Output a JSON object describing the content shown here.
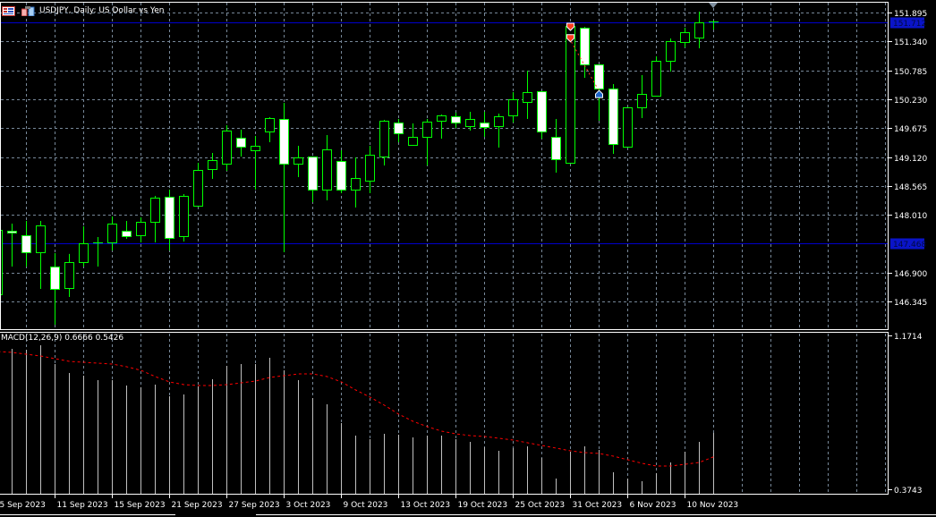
{
  "window": {
    "symbol_title": "USDJPY, Daily:  US Dollar vs Yen"
  },
  "price_axis": {
    "ticks": [
      "151.895",
      "151.340",
      "150.785",
      "150.230",
      "149.675",
      "149.120",
      "148.565",
      "148.010",
      "146.900",
      "146.345"
    ],
    "bid_label": "151.712",
    "level_label": "147.468"
  },
  "macd_axis": {
    "top": "1.1714",
    "bottom": "0.3743"
  },
  "macd_pane": {
    "label": "MACD(12,26,9) 0.6666 0.5426"
  },
  "time_axis": {
    "labels": [
      "5 Sep 2023",
      "11 Sep 2023",
      "15 Sep 2023",
      "21 Sep 2023",
      "27 Sep 2023",
      "3 Oct 2023",
      "9 Oct 2023",
      "13 Oct 2023",
      "19 Oct 2023",
      "25 Oct 2023",
      "31 Oct 2023",
      "6 Nov 2023",
      "10 Nov 2023"
    ]
  },
  "colors": {
    "background": "#000000",
    "candle_outline": "#00ff00",
    "bear_fill": "#ffffff",
    "bull_fill": "#000000",
    "grid": "#778899",
    "macd_hist": "#c0c0c0",
    "signal": "#ff0000",
    "level_line": "#0000cc",
    "sell_marker": "#ff3c1e",
    "buy_marker": "#1e64c8"
  },
  "chart_data": {
    "type": "candlestick",
    "title": "USDJPY, Daily",
    "price_range": [
      146.345,
      151.895
    ],
    "bid": 151.712,
    "level": 147.468,
    "candles": [
      {
        "date": "5 Sep 2023",
        "o": 146.483,
        "h": 147.84,
        "l": 146.483,
        "c": 147.72
      },
      {
        "date": "6 Sep 2023",
        "o": 147.703,
        "h": 147.84,
        "l": 147.016,
        "c": 147.669
      },
      {
        "date": "7 Sep 2023",
        "o": 147.617,
        "h": 147.892,
        "l": 147.016,
        "c": 147.291
      },
      {
        "date": "8 Sep 2023",
        "o": 147.291,
        "h": 147.892,
        "l": 146.586,
        "c": 147.806
      },
      {
        "date": "11 Sep 2023",
        "o": 147.016,
        "h": 147.274,
        "l": 145.899,
        "c": 146.586
      },
      {
        "date": "12 Sep 2023",
        "o": 146.604,
        "h": 147.257,
        "l": 146.432,
        "c": 147.102
      },
      {
        "date": "13 Sep 2023",
        "o": 147.102,
        "h": 147.789,
        "l": 147.016,
        "c": 147.462
      },
      {
        "date": "14 Sep 2023",
        "o": 147.462,
        "h": 147.583,
        "l": 147.016,
        "c": 147.48
      },
      {
        "date": "15 Sep 2023",
        "o": 147.48,
        "h": 147.978,
        "l": 147.325,
        "c": 147.84
      },
      {
        "date": "18 Sep 2023",
        "o": 147.703,
        "h": 147.892,
        "l": 147.548,
        "c": 147.6
      },
      {
        "date": "19 Sep 2023",
        "o": 147.617,
        "h": 147.961,
        "l": 147.48,
        "c": 147.875
      },
      {
        "date": "20 Sep 2023",
        "o": 147.875,
        "h": 148.373,
        "l": 147.48,
        "c": 148.339
      },
      {
        "date": "21 Sep 2023",
        "o": 148.356,
        "h": 148.493,
        "l": 147.325,
        "c": 147.566
      },
      {
        "date": "22 Sep 2023",
        "o": 147.6,
        "h": 148.407,
        "l": 147.497,
        "c": 148.373
      },
      {
        "date": "25 Sep 2023",
        "o": 148.184,
        "h": 149.009,
        "l": 148.184,
        "c": 148.871
      },
      {
        "date": "26 Sep 2023",
        "o": 148.889,
        "h": 149.198,
        "l": 148.699,
        "c": 149.06
      },
      {
        "date": "27 Sep 2023",
        "o": 148.992,
        "h": 149.73,
        "l": 148.854,
        "c": 149.627
      },
      {
        "date": "28 Sep 2023",
        "o": 149.49,
        "h": 149.644,
        "l": 149.129,
        "c": 149.318
      },
      {
        "date": "29 Sep 2023",
        "o": 149.249,
        "h": 149.524,
        "l": 148.493,
        "c": 149.335
      },
      {
        "date": "2 Oct 2023",
        "o": 149.61,
        "h": 149.885,
        "l": 149.404,
        "c": 149.868
      },
      {
        "date": "3 Oct 2023",
        "o": 149.851,
        "h": 150.16,
        "l": 147.291,
        "c": 148.992
      },
      {
        "date": "4 Oct 2023",
        "o": 148.992,
        "h": 149.335,
        "l": 148.734,
        "c": 149.112
      },
      {
        "date": "5 Oct 2023",
        "o": 149.129,
        "h": 149.129,
        "l": 148.253,
        "c": 148.493
      },
      {
        "date": "6 Oct 2023",
        "o": 148.493,
        "h": 149.541,
        "l": 148.287,
        "c": 149.266
      },
      {
        "date": "9 Oct 2023",
        "o": 149.043,
        "h": 149.249,
        "l": 148.425,
        "c": 148.493
      },
      {
        "date": "10 Oct 2023",
        "o": 148.493,
        "h": 149.112,
        "l": 148.15,
        "c": 148.717
      },
      {
        "date": "11 Oct 2023",
        "o": 148.665,
        "h": 149.335,
        "l": 148.425,
        "c": 149.163
      },
      {
        "date": "12 Oct 2023",
        "o": 149.129,
        "h": 149.833,
        "l": 148.957,
        "c": 149.816
      },
      {
        "date": "13 Oct 2023",
        "o": 149.782,
        "h": 149.851,
        "l": 149.404,
        "c": 149.576
      },
      {
        "date": "16 Oct 2023",
        "o": 149.352,
        "h": 149.765,
        "l": 149.335,
        "c": 149.507
      },
      {
        "date": "17 Oct 2023",
        "o": 149.507,
        "h": 149.851,
        "l": 148.957,
        "c": 149.799
      },
      {
        "date": "18 Oct 2023",
        "o": 149.816,
        "h": 149.937,
        "l": 149.473,
        "c": 149.919
      },
      {
        "date": "19 Oct 2023",
        "o": 149.902,
        "h": 149.971,
        "l": 149.679,
        "c": 149.782
      },
      {
        "date": "20 Oct 2023",
        "o": 149.713,
        "h": 149.988,
        "l": 149.627,
        "c": 149.851
      },
      {
        "date": "23 Oct 2023",
        "o": 149.782,
        "h": 149.988,
        "l": 149.507,
        "c": 149.696
      },
      {
        "date": "24 Oct 2023",
        "o": 149.713,
        "h": 149.954,
        "l": 149.301,
        "c": 149.902
      },
      {
        "date": "25 Oct 2023",
        "o": 149.919,
        "h": 150.366,
        "l": 149.782,
        "c": 150.229
      },
      {
        "date": "26 Oct 2023",
        "o": 150.177,
        "h": 150.778,
        "l": 149.851,
        "c": 150.366
      },
      {
        "date": "27 Oct 2023",
        "o": 150.383,
        "h": 150.383,
        "l": 149.473,
        "c": 149.61
      },
      {
        "date": "30 Oct 2023",
        "o": 149.507,
        "h": 149.851,
        "l": 148.82,
        "c": 149.077
      },
      {
        "date": "31 Oct 2023",
        "o": 149.009,
        "h": 151.637,
        "l": 149.009,
        "c": 151.637
      },
      {
        "date": "1 Nov 2023",
        "o": 151.603,
        "h": 151.62,
        "l": 150.641,
        "c": 150.899
      },
      {
        "date": "2 Nov 2023",
        "o": 150.899,
        "h": 150.899,
        "l": 149.816,
        "c": 150.435
      },
      {
        "date": "3 Nov 2023",
        "o": 150.435,
        "h": 150.521,
        "l": 149.181,
        "c": 149.37
      },
      {
        "date": "6 Nov 2023",
        "o": 149.318,
        "h": 150.074,
        "l": 149.318,
        "c": 150.074
      },
      {
        "date": "7 Nov 2023",
        "o": 150.074,
        "h": 150.692,
        "l": 149.868,
        "c": 150.332
      },
      {
        "date": "8 Nov 2023",
        "o": 150.297,
        "h": 151.053,
        "l": 150.297,
        "c": 150.967
      },
      {
        "date": "9 Nov 2023",
        "o": 150.967,
        "h": 151.397,
        "l": 150.761,
        "c": 151.345
      },
      {
        "date": "10 Nov 2023",
        "o": 151.328,
        "h": 151.603,
        "l": 151.225,
        "c": 151.517
      },
      {
        "date": "13 Nov 2023",
        "o": 151.414,
        "h": 151.912,
        "l": 151.208,
        "c": 151.706
      },
      {
        "date": "14 Nov 2023",
        "o": 151.723,
        "h": 151.74,
        "l": 151.569,
        "c": 151.712
      }
    ],
    "macd": {
      "params": "12,26,9",
      "range": [
        0.3743,
        1.1714
      ],
      "histogram": [
        1.1,
        1.1019,
        1.0973,
        1.1204,
        1.0231,
        0.9768,
        0.9629,
        0.9397,
        0.9397,
        0.9119,
        0.9026,
        0.9165,
        0.8563,
        0.8656,
        0.9073,
        0.9443,
        1.0138,
        1.0231,
        1.0231,
        1.0555,
        0.9907,
        0.9397,
        0.847,
        0.8146,
        0.7173,
        0.6524,
        0.6339,
        0.6617,
        0.657,
        0.6431,
        0.6524,
        0.6524,
        0.6339,
        0.62,
        0.5921,
        0.5736,
        0.5875,
        0.5968,
        0.5365,
        0.43,
        0.569,
        0.5968,
        0.5782,
        0.4624,
        0.43,
        0.4161,
        0.4578,
        0.5134,
        0.569,
        0.62,
        0.6666
      ],
      "signal": [
        1.088,
        1.0834,
        1.0741,
        1.0648,
        1.0509,
        1.037,
        1.0324,
        1.0277,
        1.0231,
        1.0092,
        0.9907,
        0.9582,
        0.9304,
        0.9165,
        0.9119,
        0.9119,
        0.9165,
        0.9258,
        0.9351,
        0.9536,
        0.9629,
        0.9721,
        0.9721,
        0.9582,
        0.9304,
        0.8887,
        0.8517,
        0.81,
        0.7636,
        0.7265,
        0.6988,
        0.6756,
        0.6617,
        0.6524,
        0.6478,
        0.6385,
        0.6292,
        0.6153,
        0.6014,
        0.5875,
        0.5736,
        0.5643,
        0.5597,
        0.5458,
        0.5273,
        0.5088,
        0.4949,
        0.4949,
        0.5041,
        0.5134,
        0.5426
      ]
    },
    "trades": [
      {
        "type": "sell",
        "date": "31 Oct 2023",
        "price": 151.62
      },
      {
        "type": "sell",
        "date": "31 Oct 2023",
        "price": 151.4
      },
      {
        "type": "buy",
        "date": "2 Nov 2023",
        "price": 150.33
      }
    ]
  }
}
